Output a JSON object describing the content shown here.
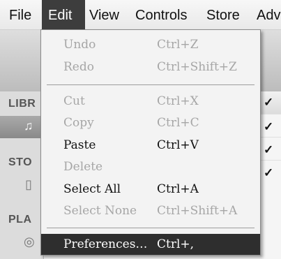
{
  "menubar": {
    "items": [
      {
        "label": "File"
      },
      {
        "label": "Edit"
      },
      {
        "label": "View"
      },
      {
        "label": "Controls"
      },
      {
        "label": "Store"
      },
      {
        "label": "Adv"
      }
    ]
  },
  "sidebar": {
    "library_heading": "LIBR",
    "store_heading": "STO",
    "playlists_heading": "PLA"
  },
  "checkmarks": [
    "✓",
    "✓",
    "✓",
    "✓"
  ],
  "edit_menu": {
    "items": [
      {
        "label": "Undo",
        "shortcut": "Ctrl+Z",
        "enabled": false
      },
      {
        "label": "Redo",
        "shortcut": "Ctrl+Shift+Z",
        "enabled": false
      },
      {
        "label": "Cut",
        "shortcut": "Ctrl+X",
        "enabled": false
      },
      {
        "label": "Copy",
        "shortcut": "Ctrl+C",
        "enabled": false
      },
      {
        "label": "Paste",
        "shortcut": "Ctrl+V",
        "enabled": true
      },
      {
        "label": "Delete",
        "shortcut": "",
        "enabled": false
      },
      {
        "label": "Select All",
        "shortcut": "Ctrl+A",
        "enabled": true
      },
      {
        "label": "Select None",
        "shortcut": "Ctrl+Shift+A",
        "enabled": false
      },
      {
        "label": "Preferences…",
        "shortcut": "Ctrl+,",
        "enabled": true,
        "highlighted": true
      }
    ]
  },
  "colors": {
    "highlight": "#2e2e2e",
    "disabled_text": "#a6a6a6",
    "menu_background": "#f3f3f3"
  }
}
